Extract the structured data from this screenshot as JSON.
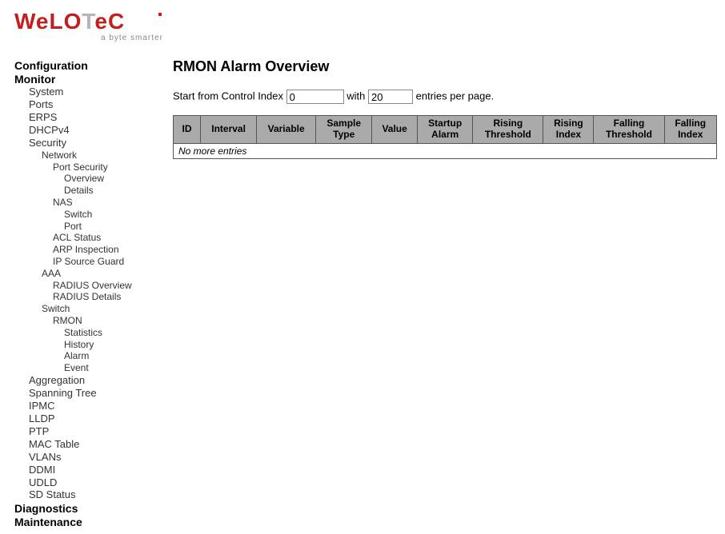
{
  "brand": {
    "name": "WeLOTeC",
    "tagline": "a byte smarter"
  },
  "sidebar": {
    "configuration": "Configuration",
    "monitor": "Monitor",
    "system": "System",
    "ports": "Ports",
    "erps": "ERPS",
    "dhcpv4": "DHCPv4",
    "security": "Security",
    "network": "Network",
    "port_security": "Port Security",
    "overview": "Overview",
    "details": "Details",
    "nas": "NAS",
    "switch": "Switch",
    "port": "Port",
    "acl_status": "ACL Status",
    "arp_inspection": "ARP Inspection",
    "ip_source_guard": "IP Source Guard",
    "aaa": "AAA",
    "radius_overview": "RADIUS Overview",
    "radius_details": "RADIUS Details",
    "switch2": "Switch",
    "rmon": "RMON",
    "statistics": "Statistics",
    "history": "History",
    "alarm": "Alarm",
    "event": "Event",
    "aggregation": "Aggregation",
    "spanning_tree": "Spanning Tree",
    "ipmc": "IPMC",
    "lldp": "LLDP",
    "ptp": "PTP",
    "mac_table": "MAC Table",
    "vlans": "VLANs",
    "ddmi": "DDMI",
    "udld": "UDLD",
    "sd_status": "SD Status",
    "diagnostics": "Diagnostics",
    "maintenance": "Maintenance"
  },
  "main": {
    "title": "RMON Alarm Overview",
    "filter": {
      "prefix": "Start from Control Index",
      "start_value": "0",
      "mid": "with",
      "count_value": "20",
      "suffix": "entries per page."
    },
    "columns": {
      "id": "ID",
      "interval": "Interval",
      "variable": "Variable",
      "sample_type": "Sample Type",
      "value": "Value",
      "startup_alarm": "Startup Alarm",
      "rising_threshold": "Rising Threshold",
      "rising_index": "Rising Index",
      "falling_threshold": "Falling Threshold",
      "falling_index": "Falling Index"
    },
    "empty_row": "No more entries"
  }
}
